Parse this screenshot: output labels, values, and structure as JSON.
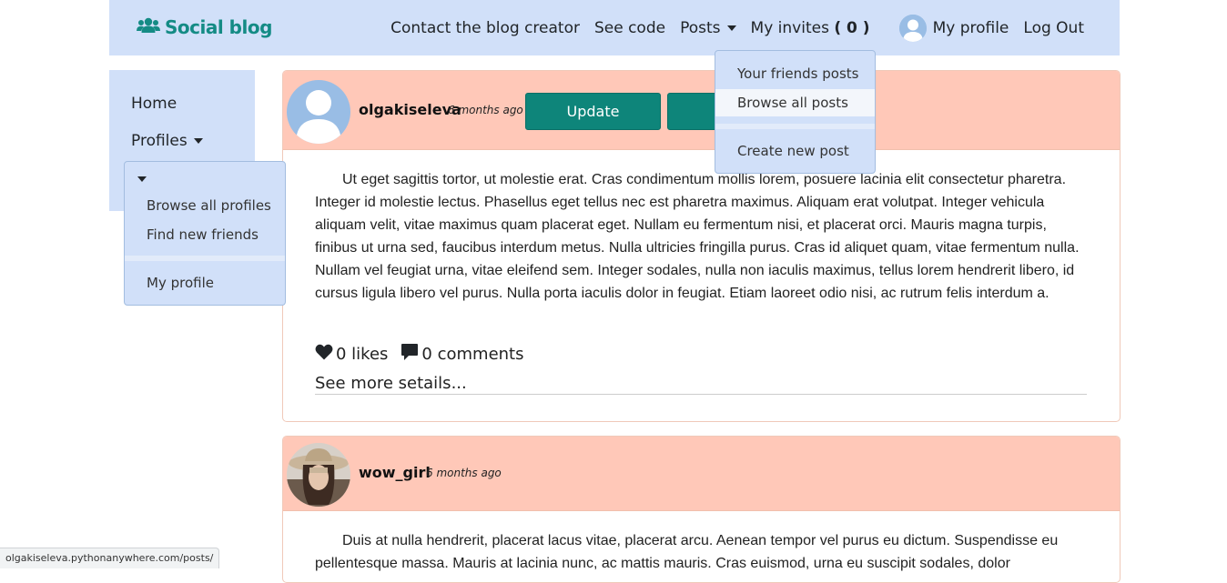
{
  "navbar": {
    "brand": "Social blog",
    "links": {
      "contact": "Contact the blog creator",
      "code": "See code",
      "posts": "Posts",
      "invites_label": "My invites",
      "invites_count": "( 0 )",
      "profile": "My profile",
      "logout": "Log Out"
    }
  },
  "posts_menu": {
    "items": [
      "Your friends posts",
      "Browse all posts",
      "Create new post"
    ]
  },
  "sidebar": {
    "home": "Home",
    "profiles": "Profiles"
  },
  "profiles_menu": {
    "items": [
      "Browse all profiles",
      "Find new friends",
      "My profile"
    ]
  },
  "posts": [
    {
      "author": "olgakiseleva",
      "time": "6 months ago",
      "update_label": "Update",
      "text": "Ut eget sagittis tortor, ut molestie erat. Cras condimentum mollis lorem, posuere lacinia elit consectetur pharetra. Integer id molestie lectus. Phasellus eget tellus nec est pharetra maximus. Aliquam erat volutpat. Integer vehicula aliquam velit, vitae maximus quam placerat eget. Nullam eu fermentum nisi, et placerat orci. Mauris magna turpis, finibus ut urna sed, faucibus interdum metus. Nulla ultricies fringilla purus. Cras id aliquet quam, vitae fermentum nulla. Nullam vel feugiat urna, vitae eleifend sem. Integer sodales, nulla non iaculis maximus, tellus lorem hendrerit libero, id cursus ligula libero vel purus. Nulla porta iaculis dolor in feugiat. Etiam laoreet odio nisi, ac rutrum felis interdum a.",
      "likes": "0 likes",
      "comments": "0 comments",
      "more": "See more setails..."
    },
    {
      "author": "wow_girl",
      "time": "6 months ago",
      "text": "Duis at nulla hendrerit, placerat lacus vitae, placerat arcu. Aenean tempor vel purus eu dictum. Suspendisse eu pellentesque massa. Mauris at lacinia nunc, ac mattis mauris. Cras euismod, urna eu suscipit sodales, dolor"
    }
  ],
  "statusbar": {
    "url": "olgakiseleva.pythonanywhere.com/posts/"
  },
  "colors": {
    "navbar_bg": "#d1e0f9",
    "brand": "#148b85",
    "post_header": "#ffc8b8",
    "button": "#0e857a"
  },
  "icons": {
    "brand": "users-icon",
    "like": "heart-icon",
    "comment": "comment-icon",
    "avatar_default": "user-silhouette-icon"
  }
}
